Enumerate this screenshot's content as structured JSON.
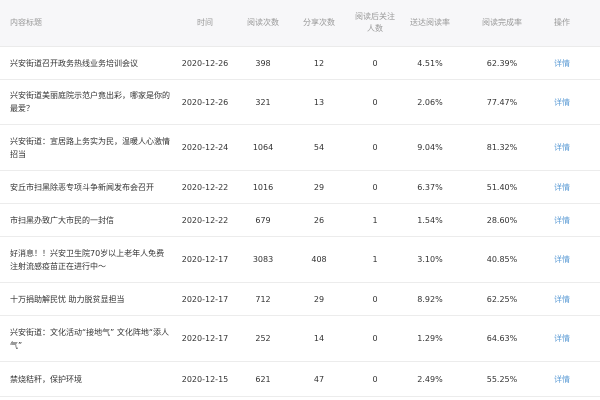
{
  "headers": {
    "title": "内容标题",
    "time": "时间",
    "reads": "阅读次数",
    "shares": "分享次数",
    "follows": "阅读后关注人数",
    "reach_rate": "送达阅读率",
    "completion_rate": "阅读完成率",
    "action": "操作"
  },
  "rows": [
    {
      "title": "兴安街道召开政务热线业务培训会议",
      "time": "2020-12-26",
      "reads": "398",
      "shares": "12",
      "follows": "0",
      "reach_rate": "4.51%",
      "completion_rate": "62.39%",
      "action": "详情"
    },
    {
      "title": "兴安街道美丽庭院示范户竟出彩，哪家是你的最爱？",
      "time": "2020-12-26",
      "reads": "321",
      "shares": "13",
      "follows": "0",
      "reach_rate": "2.06%",
      "completion_rate": "77.47%",
      "action": "详情"
    },
    {
      "title": "兴安街道：宣居路上务实为民，温暖人心激情招当",
      "time": "2020-12-24",
      "reads": "1064",
      "shares": "54",
      "follows": "0",
      "reach_rate": "9.04%",
      "completion_rate": "81.32%",
      "action": "详情"
    },
    {
      "title": "安丘市扫黑除恶专项斗争新闻发布会召开",
      "time": "2020-12-22",
      "reads": "1016",
      "shares": "29",
      "follows": "0",
      "reach_rate": "6.37%",
      "completion_rate": "51.40%",
      "action": "详情"
    },
    {
      "title": "市扫黑办致广大市民的一封信",
      "time": "2020-12-22",
      "reads": "679",
      "shares": "26",
      "follows": "1",
      "reach_rate": "1.54%",
      "completion_rate": "28.60%",
      "action": "详情"
    },
    {
      "title": "好消息！！兴安卫生院70岁以上老年人免费注射流感疫苗正在进行中～",
      "time": "2020-12-17",
      "reads": "3083",
      "shares": "408",
      "follows": "1",
      "reach_rate": "3.10%",
      "completion_rate": "40.85%",
      "action": "详情"
    },
    {
      "title": "十万捐助解民忧 助力脱贫显担当",
      "time": "2020-12-17",
      "reads": "712",
      "shares": "29",
      "follows": "0",
      "reach_rate": "8.92%",
      "completion_rate": "62.25%",
      "action": "详情"
    },
    {
      "title": "兴安街道：文化活动“接地气” 文化阵地“添人气”",
      "time": "2020-12-17",
      "reads": "252",
      "shares": "14",
      "follows": "0",
      "reach_rate": "1.29%",
      "completion_rate": "64.63%",
      "action": "详情"
    },
    {
      "title": "禁烧秸秆，保护环境",
      "time": "2020-12-15",
      "reads": "621",
      "shares": "47",
      "follows": "0",
      "reach_rate": "2.49%",
      "completion_rate": "55.25%",
      "action": "详情"
    }
  ]
}
